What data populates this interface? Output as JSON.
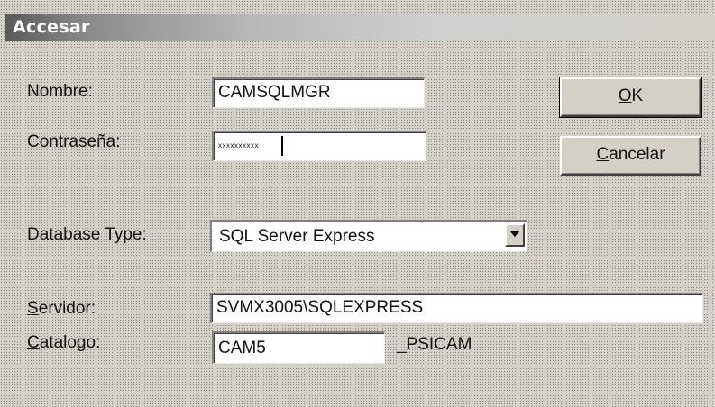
{
  "window": {
    "title": "Accesar"
  },
  "labels": {
    "nombre": "Nombre:",
    "contrasena": "Contraseña:",
    "database_type": "Database Type:",
    "servidor_mnemonic": "S",
    "servidor_rest": "ervidor:",
    "catalogo_mnemonic": "C",
    "catalogo_rest": "atalogo:"
  },
  "fields": {
    "nombre_value": "CAMSQLMGR",
    "contrasena_value": "xxxxxxxxxx",
    "database_type_value": "SQL Server Express",
    "servidor_value": "SVMX3005\\SQLEXPRESS",
    "catalogo_value": "CAM5",
    "catalogo_suffix": "_PSICAM"
  },
  "buttons": {
    "ok_mnemonic": "O",
    "ok_rest": "K",
    "cancel_mnemonic": "C",
    "cancel_rest": "ancelar"
  },
  "icons": {
    "dropdown": "chevron-down-icon"
  },
  "colors": {
    "face": "#d4d0c8",
    "field": "#ffffff",
    "title_text": "#ffffff"
  }
}
